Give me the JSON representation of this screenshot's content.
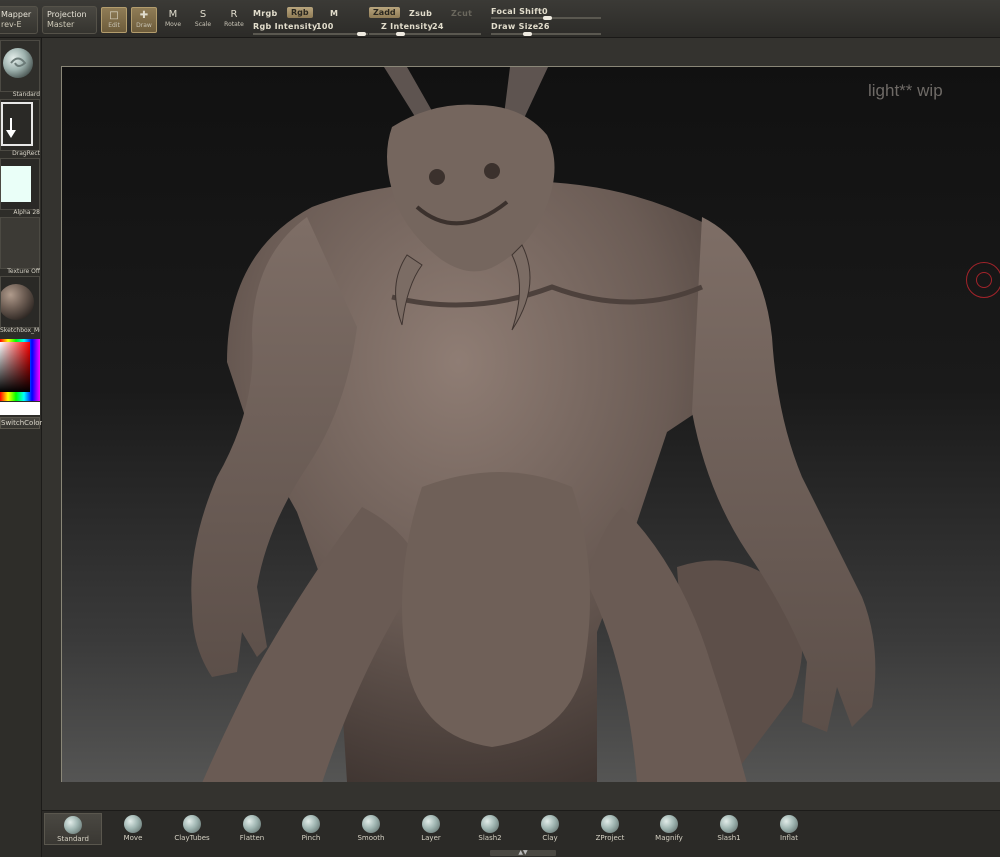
{
  "toolbar": {
    "mapper_label": "Mapper",
    "mapper_sub": "rev-E",
    "projection_label": "Projection",
    "projection_sub": "Master",
    "edit_label": "Edit",
    "draw_label": "Draw",
    "move_label": "Move",
    "move_key": "M",
    "scale_label": "Scale",
    "scale_key": "S",
    "rotate_label": "Rotate",
    "rotate_key": "R",
    "mrgb_label": "Mrgb",
    "rgb_label": "Rgb",
    "m_label": "M",
    "rgb_intensity_label": "Rgb Intensity",
    "rgb_intensity_value": "100",
    "zadd_label": "Zadd",
    "zsub_label": "Zsub",
    "zcut_label": "Zcut",
    "z_intensity_label": "Z Intensity",
    "z_intensity_value": "24",
    "focal_shift_label": "Focal Shift",
    "focal_shift_value": "0",
    "draw_size_label": "Draw Size",
    "draw_size_value": "26"
  },
  "left_shelf": [
    {
      "label": "Standard",
      "icon": "standard-brush-icon"
    },
    {
      "label": "DragRect",
      "icon": "dragrect-stroke-icon"
    },
    {
      "label": "Alpha 28",
      "icon": "alpha-icon"
    },
    {
      "label": "Texture Off",
      "icon": "texture-icon"
    },
    {
      "label": "Sketchbox_Mud",
      "icon": "material-sphere-icon"
    },
    {
      "label": "SwitchColor",
      "icon": "color-picker-icon"
    }
  ],
  "canvas": {
    "watermark": "light** wip",
    "model": "sculpted demon figure"
  },
  "bottom_shelf": [
    {
      "label": "Standard",
      "selected": true
    },
    {
      "label": "Move",
      "selected": false
    },
    {
      "label": "ClayTubes",
      "selected": false
    },
    {
      "label": "Flatten",
      "selected": false
    },
    {
      "label": "Pinch",
      "selected": false
    },
    {
      "label": "Smooth",
      "selected": false
    },
    {
      "label": "Layer",
      "selected": false
    },
    {
      "label": "Slash2",
      "selected": false
    },
    {
      "label": "Clay",
      "selected": false
    },
    {
      "label": "ZProject",
      "selected": false
    },
    {
      "label": "Magnify",
      "selected": false
    },
    {
      "label": "Slash1",
      "selected": false
    },
    {
      "label": "Inflat",
      "selected": false
    }
  ],
  "colors": {
    "accent": "#8f7b55",
    "cursor": "#a2232a",
    "clay": "#6b5c55"
  }
}
